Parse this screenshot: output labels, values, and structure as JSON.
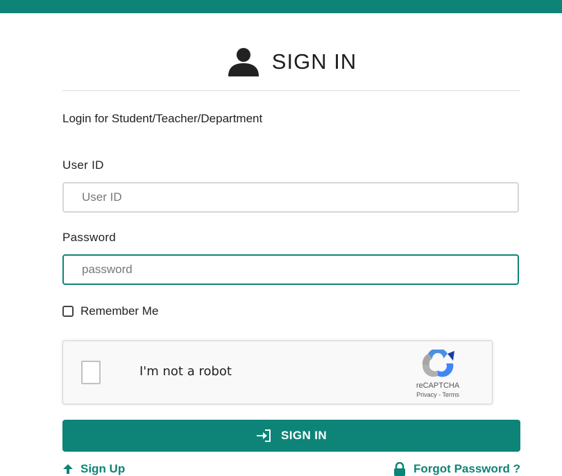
{
  "header": {
    "title": "SIGN IN",
    "subtitle": "Login for Student/Teacher/Department"
  },
  "form": {
    "user_id_label": "User ID",
    "user_id_placeholder": "User ID",
    "password_label": "Password",
    "password_placeholder": "password",
    "remember_label": "Remember Me",
    "remember_checked": false
  },
  "captcha": {
    "label": "I'm not a robot",
    "brand": "reCAPTCHA",
    "links": "Privacy - Terms"
  },
  "actions": {
    "signin_label": "SIGN IN",
    "signup_label": "Sign Up",
    "forgot_label": "Forgot Password ?"
  },
  "colors": {
    "accent": "#0d8477"
  }
}
